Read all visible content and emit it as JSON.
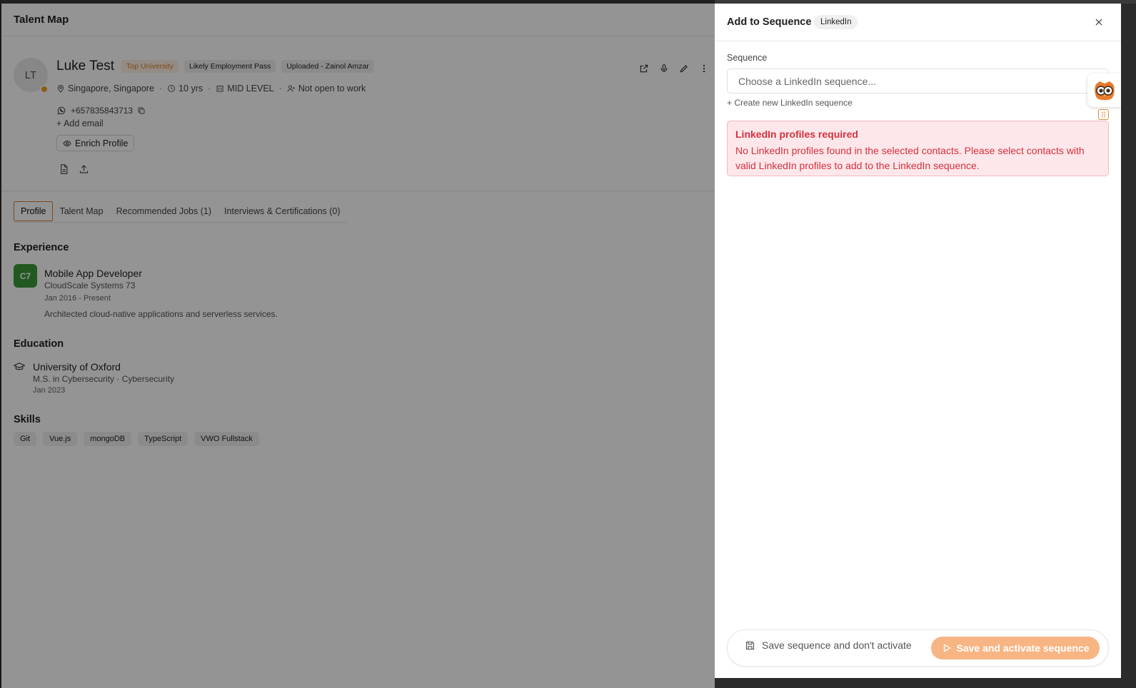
{
  "page": {
    "header_title": "Talent Map"
  },
  "candidate": {
    "initials": "LT",
    "name": "Luke Test",
    "tags": [
      "Top University",
      "Likely Employment Pass",
      "Uploaded - Zainol Amzar"
    ],
    "location": "Singapore, Singapore",
    "experience_years": "10 yrs",
    "level": "MID LEVEL",
    "work_status": "Not open to work",
    "phone": "+657835843713",
    "add_email_label": "+ Add email",
    "enrich_label": "Enrich Profile"
  },
  "tabs": [
    {
      "label": "Profile",
      "active": true
    },
    {
      "label": "Talent Map",
      "active": false
    },
    {
      "label": "Recommended Jobs (1)",
      "active": false
    },
    {
      "label": "Interviews & Certifications (0)",
      "active": false
    }
  ],
  "experience": {
    "section_title": "Experience",
    "logo_text": "C7",
    "role": "Mobile App Developer",
    "company": "CloudScale Systems 73",
    "dates": "Jan 2016 - Present",
    "description": "Architected cloud-native applications and serverless services."
  },
  "education": {
    "section_title": "Education",
    "school": "University of Oxford",
    "degree": "M.S. in Cybersecurity · Cybersecurity",
    "date": "Jan 2023"
  },
  "skills": {
    "section_title": "Skills",
    "items": [
      "Git",
      "Vue.js",
      "mongoDB",
      "TypeScript",
      "VWO Fullstack"
    ]
  },
  "panel": {
    "title": "Add to Sequence",
    "badge": "LinkedIn",
    "field_label": "Sequence",
    "select_placeholder": "Choose a LinkedIn sequence...",
    "create_link": "+ Create new LinkedIn sequence",
    "alert_title": "LinkedIn profiles required",
    "alert_message": "No LinkedIn profiles found in the selected contacts. Please select contacts with valid LinkedIn profiles to add to the LinkedIn sequence.",
    "save_label": "Save sequence and don't activate",
    "activate_label": "Save and activate sequence"
  },
  "colors": {
    "accent": "#e07a2a",
    "activate_button": "#f8b584",
    "alert_text": "#d6303d",
    "alert_bg": "#fde7ea"
  }
}
